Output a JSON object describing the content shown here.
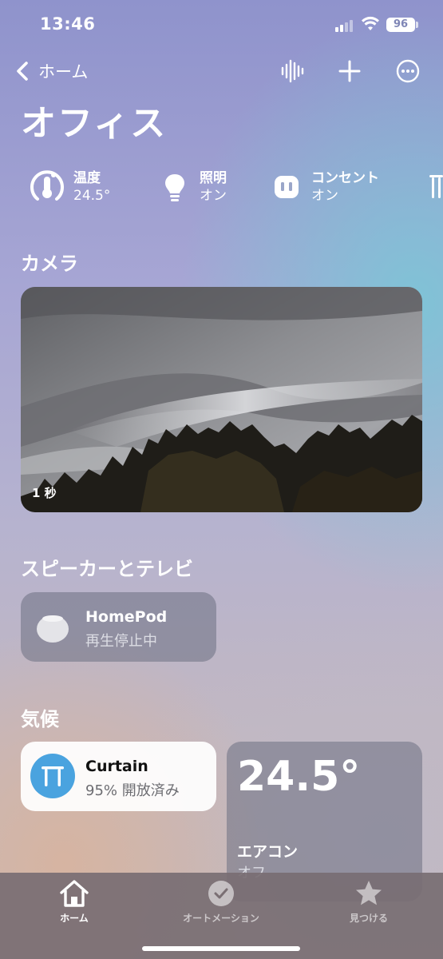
{
  "status_bar": {
    "time": "13:46",
    "battery": "96"
  },
  "nav": {
    "back_label": "ホーム"
  },
  "page": {
    "title": "オフィス"
  },
  "chips": [
    {
      "label": "温度",
      "value": "24.5°",
      "icon": "thermometer-icon"
    },
    {
      "label": "照明",
      "value": "オン",
      "icon": "lightbulb-icon"
    },
    {
      "label": "コンセント",
      "value": "オン",
      "icon": "outlet-icon"
    }
  ],
  "sections": {
    "camera": "カメラ",
    "speakers": "スピーカーとテレビ",
    "climate": "気候"
  },
  "camera": {
    "age": "1 秒"
  },
  "homepod": {
    "name": "HomePod",
    "status": "再生停止中"
  },
  "curtain": {
    "name": "Curtain",
    "status": "95% 開放済み"
  },
  "aircon": {
    "temperature": "24.5°",
    "name": "エアコン",
    "status": "オフ"
  },
  "tab_bar": {
    "home": "ホーム",
    "automation": "オートメーション",
    "discover": "見つける"
  }
}
